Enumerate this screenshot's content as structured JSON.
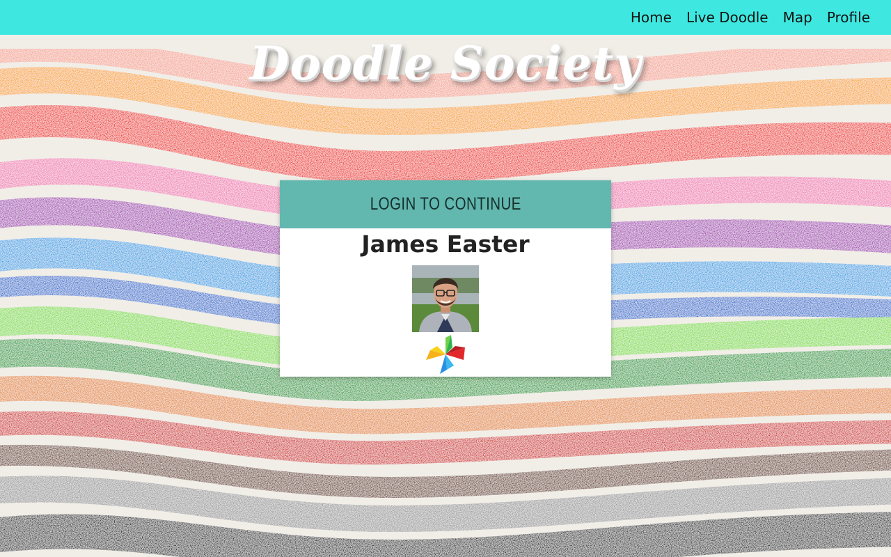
{
  "nav": {
    "links": [
      "Home",
      "Live Doodle",
      "Map",
      "Profile"
    ]
  },
  "site_title": "Doodle Society",
  "login_card": {
    "header": "LOGIN TO CONTINUE",
    "user_name": "James Easter"
  },
  "icons": {
    "avatar": "user-photo",
    "logo": "pinwheel-logo"
  },
  "colors": {
    "navbar": "#3ee8e0",
    "card_header": "#62b7af"
  }
}
